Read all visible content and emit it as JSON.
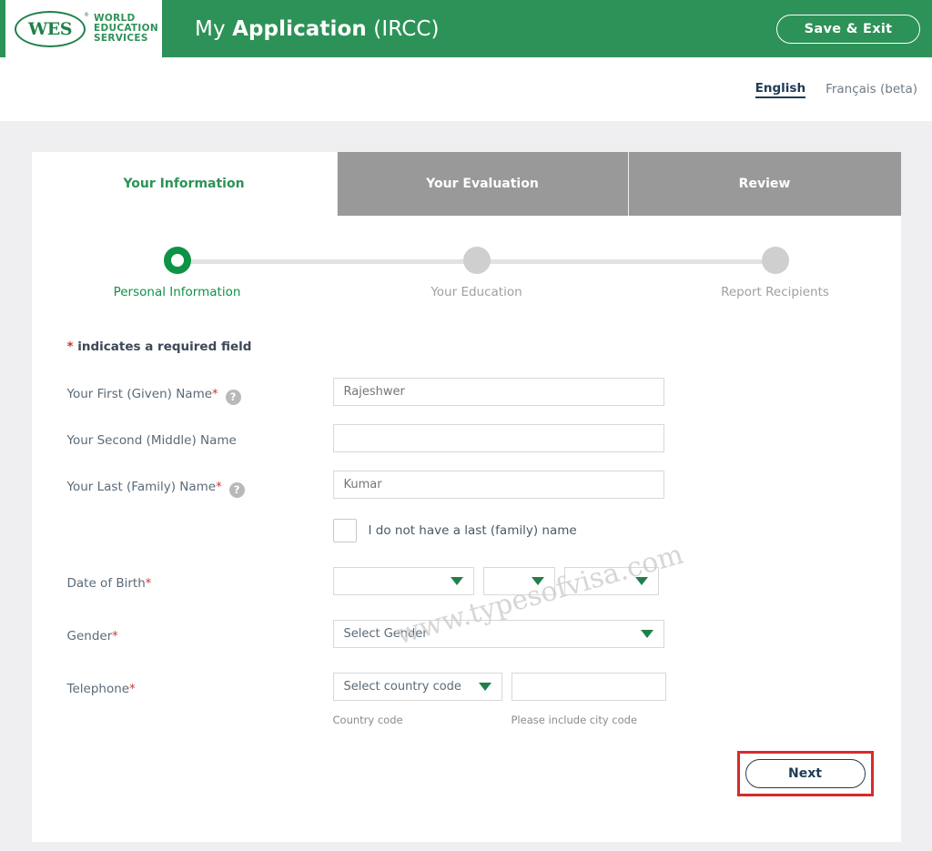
{
  "header": {
    "logo": {
      "mark": "WES",
      "registered": "®",
      "line1": "WORLD",
      "line2": "EDUCATION",
      "line3": "SERVICES"
    },
    "title_prefix": "My ",
    "title_bold": "Application",
    "title_suffix": " (IRCC)",
    "save_exit_label": "Save & Exit",
    "green": "#2d9257"
  },
  "language": {
    "english_label": "English",
    "french_label": "Français (beta)"
  },
  "tabs": [
    {
      "label": "Your Information",
      "active": true
    },
    {
      "label": "Your Evaluation",
      "active": false
    },
    {
      "label": "Review",
      "active": false
    }
  ],
  "stepper": [
    {
      "label": "Personal Information",
      "state": "active"
    },
    {
      "label": "Your Education",
      "state": "idle"
    },
    {
      "label": "Report Recipients",
      "state": "idle"
    }
  ],
  "form": {
    "required_star": "*",
    "required_note": "indicates a required field",
    "help_glyph": "?",
    "first_name": {
      "label": "Your First (Given) Name",
      "required": "*",
      "value": "Rajeshwer",
      "placeholder": "Rajeshwer"
    },
    "middle_name": {
      "label": "Your Second (Middle) Name",
      "value": "",
      "placeholder": ""
    },
    "last_name": {
      "label": "Your Last (Family) Name",
      "required": "*",
      "value": "Kumar",
      "placeholder": "Kumar"
    },
    "no_last_name": {
      "label": "I do not have a last (family) name",
      "checked": false
    },
    "dob": {
      "label": "Date of Birth",
      "required": "*",
      "month_value": "",
      "day_value": "",
      "year_value": ""
    },
    "gender": {
      "label": "Gender",
      "required": "*",
      "value": "Select Gender"
    },
    "telephone": {
      "label": "Telephone",
      "required": "*",
      "country_code_value": "Select country code",
      "number_value": "",
      "country_code_hint": "Country code",
      "number_hint": "Please include city code"
    }
  },
  "footer": {
    "next_label": "Next",
    "highlight_color": "#d62b2b"
  },
  "watermark": {
    "text": "www.typesofvisa.com"
  }
}
